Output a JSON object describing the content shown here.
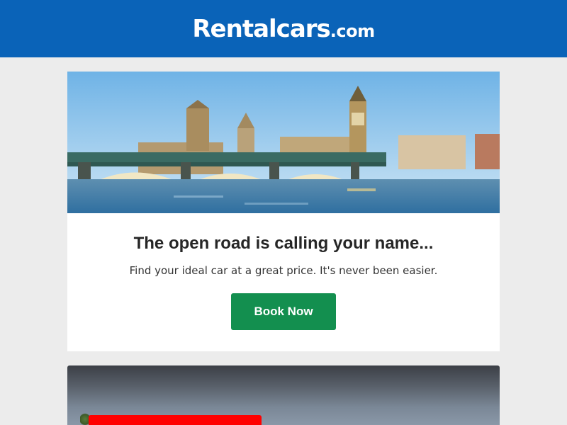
{
  "brand": {
    "logo_main": "Rentalcars",
    "logo_tld": ".com",
    "header_color": "#0a63b8"
  },
  "hero": {
    "image_alt": "Westminster Bridge and Big Ben, London"
  },
  "promo": {
    "headline": "The open road is calling your name...",
    "subline": "Find your ideal car at a great price. It's never been easier.",
    "cta_label": "Book Now",
    "cta_color": "#138f4f"
  },
  "second_card": {
    "accent_color": "#ff0000"
  }
}
